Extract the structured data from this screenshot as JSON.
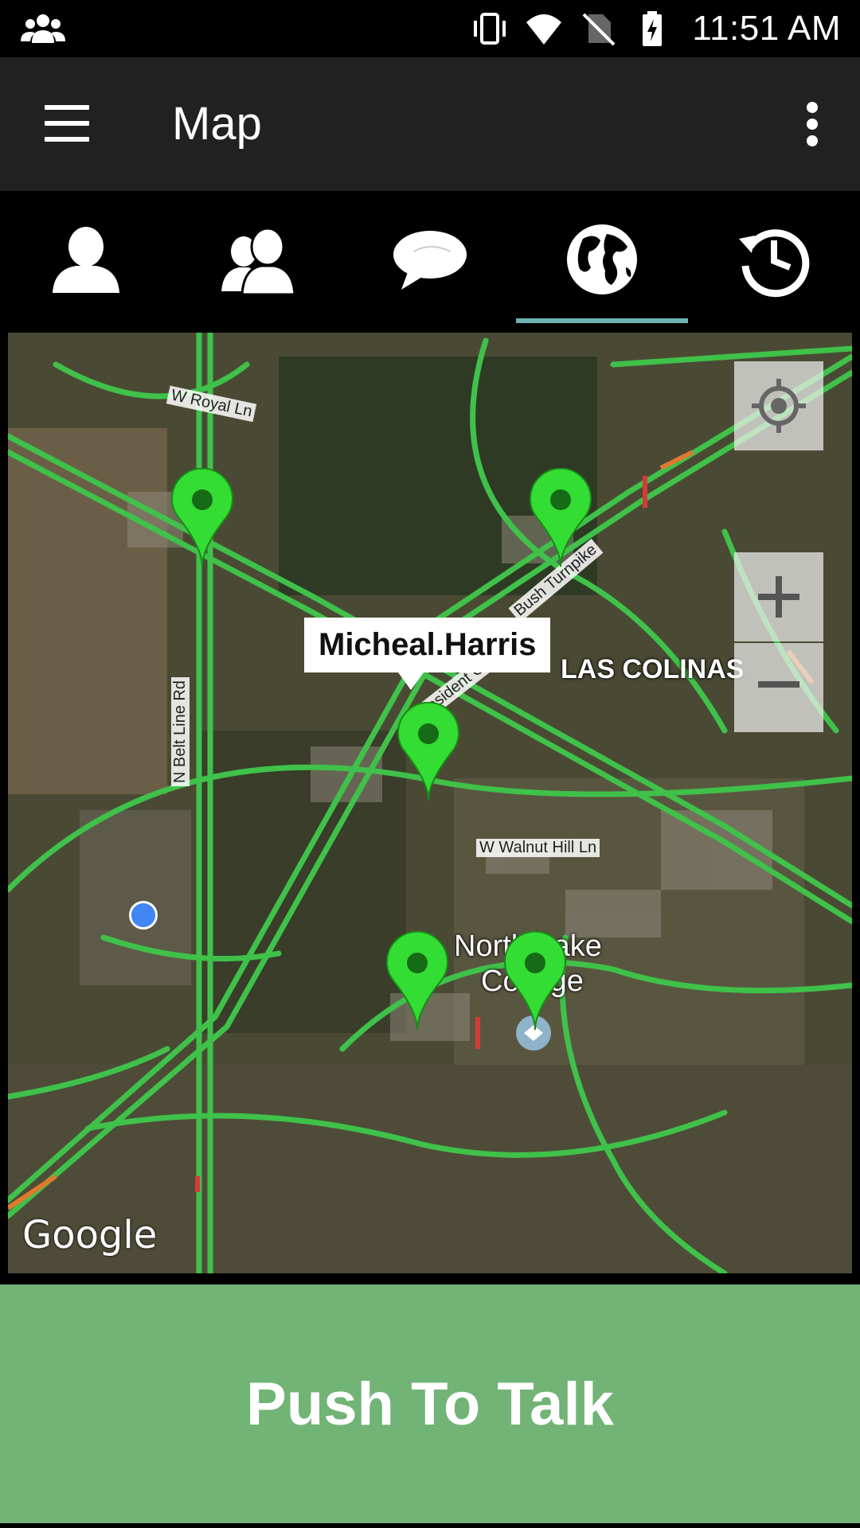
{
  "status_bar": {
    "time": "11:51 AM",
    "icons": [
      "group-notification-icon",
      "vibrate-icon",
      "wifi-icon",
      "no-sim-icon",
      "battery-charging-icon"
    ]
  },
  "toolbar": {
    "title": "Map",
    "menu_icon": "hamburger-menu-icon",
    "overflow_icon": "overflow-menu-icon"
  },
  "tabs": [
    {
      "name": "contact",
      "icon": "person-icon",
      "active": false
    },
    {
      "name": "groups",
      "icon": "group-icon",
      "active": false
    },
    {
      "name": "messages",
      "icon": "chat-bubbles-icon",
      "active": false
    },
    {
      "name": "map",
      "icon": "globe-icon",
      "active": true
    },
    {
      "name": "history",
      "icon": "history-icon",
      "active": false
    }
  ],
  "map": {
    "labels": {
      "area": "LAS COLINAS",
      "college_line1": "North Lake",
      "college_line2": "College"
    },
    "roads": {
      "royal": "W Royal Ln",
      "belt": "N Belt Line Rd",
      "walnut": "W Walnut Hill Ln",
      "turnpike": "Bush Turnpike",
      "president": "President G"
    },
    "callout": "Micheal.Harris",
    "attribution": "Google",
    "pin_color": "#33dd33",
    "location_dot_color": "#4285f4"
  },
  "ptt": {
    "label": "Push To Talk",
    "color": "#72b376"
  }
}
